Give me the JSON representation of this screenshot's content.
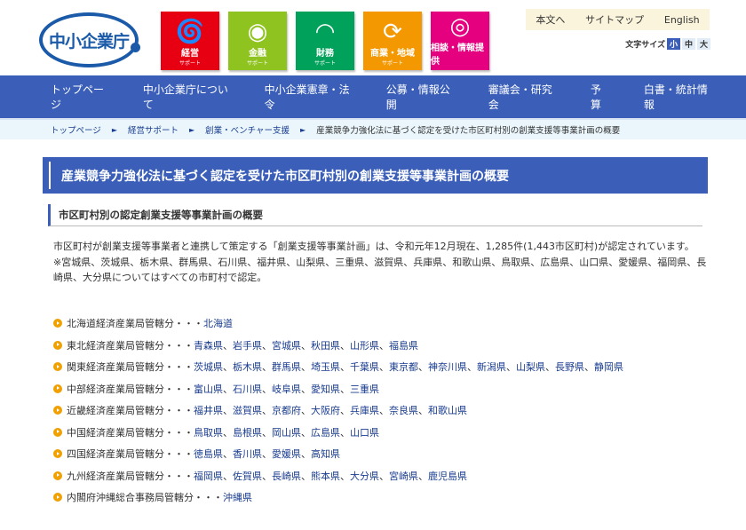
{
  "header": {
    "logo": "中小企業庁",
    "tiles": [
      {
        "title": "経営",
        "sub": "サポート",
        "color": "#e60012",
        "icon": "tornado-icon"
      },
      {
        "title": "金融",
        "sub": "サポート",
        "color": "#8fc31f",
        "icon": "waves-icon"
      },
      {
        "title": "財務",
        "sub": "サポート",
        "color": "#00a15a",
        "icon": "signal-icon"
      },
      {
        "title": "商業・地域",
        "sub": "サポート",
        "color": "#f39800",
        "icon": "cycle-icon"
      },
      {
        "title": "相談・情報提供",
        "sub": "",
        "color": "#e4007f",
        "icon": "spiral-icon"
      }
    ],
    "util": [
      "本文へ",
      "サイトマップ",
      "English"
    ],
    "font_size_label": "文字サイズ",
    "font_sizes": [
      "小",
      "中",
      "大"
    ]
  },
  "nav": [
    "トップページ",
    "中小企業庁について",
    "中小企業憲章・法令",
    "公募・情報公開",
    "審議会・研究会",
    "予算",
    "白書・統計情報"
  ],
  "breadcrumb": [
    "トップページ",
    "経営サポート",
    "創業・ベンチャー支援",
    "産業競争力強化法に基づく認定を受けた市区町村別の創業支援等事業計画の概要"
  ],
  "title": "産業競争力強化法に基づく認定を受けた市区町村別の創業支援等事業計画の概要",
  "subtitle": "市区町村別の認定創業支援等事業計画の概要",
  "para1": "市区町村が創業支援等事業者と連携して策定する「創業支援等事業計画」は、令和元年12月現在、1,285件(1,443市区町村)が認定されています。",
  "para2": "※宮城県、茨城県、栃木県、群馬県、石川県、福井県、山梨県、三重県、滋賀県、兵庫県、和歌山県、鳥取県、広島県、山口県、愛媛県、福岡県、長崎県、大分県についてはすべての市町村で認定。",
  "regions": [
    {
      "label": "北海道経済産業局管轄分・・・",
      "links": [
        "北海道"
      ]
    },
    {
      "label": "東北経済産業局管轄分・・・",
      "links": [
        "青森県",
        "岩手県",
        "宮城県",
        "秋田県",
        "山形県",
        "福島県"
      ]
    },
    {
      "label": "関東経済産業局管轄分・・・",
      "links": [
        "茨城県",
        "栃木県",
        "群馬県",
        "埼玉県",
        "千葉県",
        "東京都",
        "神奈川県",
        "新潟県",
        "山梨県",
        "長野県",
        "静岡県"
      ]
    },
    {
      "label": "中部経済産業局管轄分・・・",
      "links": [
        "富山県",
        "石川県",
        "岐阜県",
        "愛知県",
        "三重県"
      ]
    },
    {
      "label": "近畿経済産業局管轄分・・・",
      "links": [
        "福井県",
        "滋賀県",
        "京都府",
        "大阪府",
        "兵庫県",
        "奈良県",
        "和歌山県"
      ]
    },
    {
      "label": "中国経済産業局管轄分・・・",
      "links": [
        "鳥取県",
        "島根県",
        "岡山県",
        "広島県",
        "山口県"
      ]
    },
    {
      "label": "四国経済産業局管轄分・・・",
      "links": [
        "徳島県",
        "香川県",
        "愛媛県",
        "高知県"
      ]
    },
    {
      "label": "九州経済産業局管轄分・・・",
      "links": [
        "福岡県",
        "佐賀県",
        "長崎県",
        "熊本県",
        "大分県",
        "宮崎県",
        "鹿児島県"
      ]
    },
    {
      "label": "内閣府沖縄総合事務局管轄分・・・",
      "links": [
        "沖縄県"
      ]
    }
  ]
}
